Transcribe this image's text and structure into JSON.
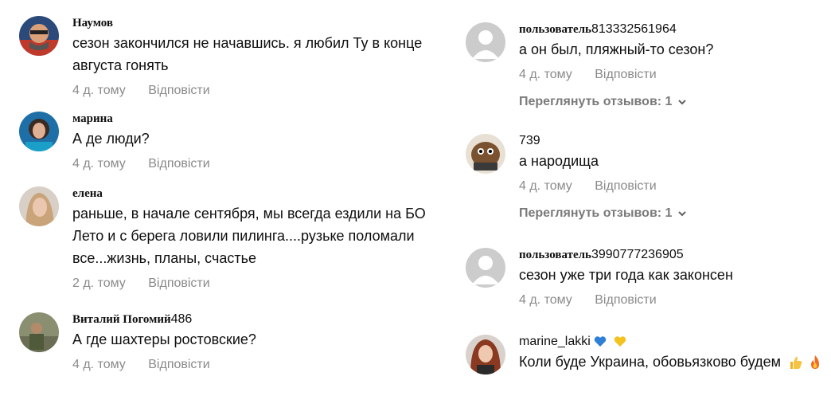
{
  "left": [
    {
      "author": "Наумов",
      "author_num": "",
      "text": "сезон закончился не начавшись. я любил Ту в конце августа гонять",
      "time": "4 д. тому",
      "reply": "Відповісти"
    },
    {
      "author": "марина",
      "author_num": "",
      "text": "А де люди?",
      "time": "4 д. тому",
      "reply": "Відповісти"
    },
    {
      "author": "елена",
      "author_num": "",
      "text": "раньше, в начале сентября, мы всегда ездили на БО Лето и с берега ловили пилинга....рузьке поломали все...жизнь, планы, счастье",
      "time": "2 д. тому",
      "reply": "Відповісти"
    },
    {
      "author": "Виталий Погомий",
      "author_num": "486",
      "text": "А где шахтеры ростовские?",
      "time": "4 д. тому",
      "reply": "Відповісти"
    }
  ],
  "right": [
    {
      "author": "пользователь",
      "author_num": "813332561964",
      "text": "а он был, пляжный-то сезон?",
      "time": "4 д. тому",
      "reply": "Відповісти",
      "replies": "Переглянуть отзывов: 1"
    },
    {
      "author": "",
      "author_num": "739",
      "text": "а народища",
      "time": "4 д. тому",
      "reply": "Відповісти",
      "replies": "Переглянуть отзывов: 1"
    },
    {
      "author": "пользователь",
      "author_num": "3990777236905",
      "text": "сезон уже три года как законсен",
      "time": "4 д. тому",
      "reply": "Відповісти"
    },
    {
      "author": "marine_lakki",
      "author_num": "",
      "text": "Коли буде Украина, обовьязково будем",
      "time": "",
      "reply": ""
    }
  ],
  "colors": {
    "text": "#0f0f0f",
    "meta": "#8a8a8a",
    "replies": "#7a7a7a",
    "default_avatar_bg": "#cccccc"
  },
  "icons": [
    "heart-blue-icon",
    "heart-yellow-icon",
    "thumbs-up-icon",
    "fire-icon",
    "chevron-down-icon",
    "default-avatar-icon"
  ]
}
